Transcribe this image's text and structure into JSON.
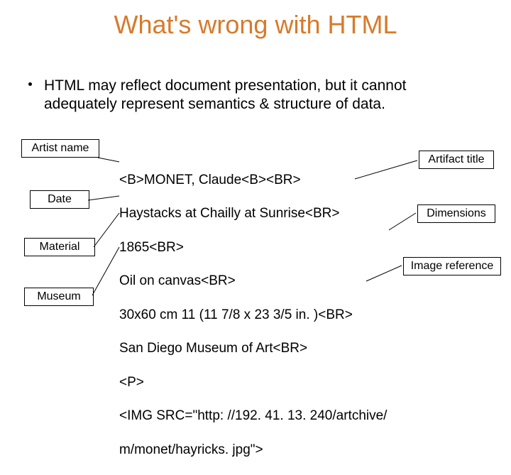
{
  "title": "What's wrong with HTML",
  "bullet": "HTML may reflect document presentation, but it cannot adequately represent semantics & structure of data.",
  "labels": {
    "artist": "Artist name",
    "date": "Date",
    "material": "Material",
    "museum": "Museum",
    "artifact_title": "Artifact title",
    "dimensions": "Dimensions",
    "image_ref": "Image reference"
  },
  "code_lines": {
    "l0": "<B>MONET, Claude<B><BR>",
    "l1": "Haystacks at Chailly at Sunrise<BR>",
    "l2": "1865<BR>",
    "l3": "Oil on canvas<BR>",
    "l4": "30x60 cm 11 (11 7/8 x 23 3/5 in. )<BR>",
    "l5": "San Diego Museum of Art<BR>",
    "l6": "<P>",
    "l7": "<IMG SRC=\"http: //192. 41. 13. 240/artchive/",
    "l8": "m/monet/hayricks. jpg\">"
  }
}
